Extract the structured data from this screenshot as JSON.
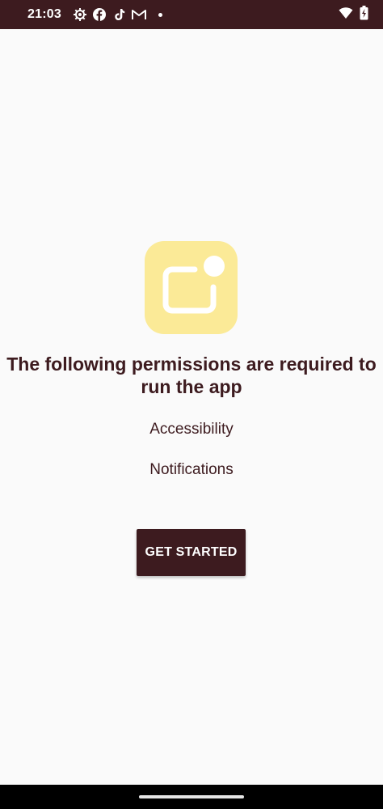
{
  "status_bar": {
    "time": "21:03",
    "left_icons": [
      "settings-gear-icon",
      "facebook-icon",
      "tiktok-icon",
      "gmail-icon",
      "notification-dot"
    ],
    "right_icons": [
      "wifi-icon",
      "battery-charging-icon"
    ]
  },
  "onboarding": {
    "title": "The following permissions are required to run the app",
    "permissions": [
      "Accessibility",
      "Notifications"
    ],
    "button_label": "GET STARTED"
  },
  "colors": {
    "primary": "#3d1b1f",
    "background": "#fafafa",
    "icon_bg": "#fbea97"
  }
}
